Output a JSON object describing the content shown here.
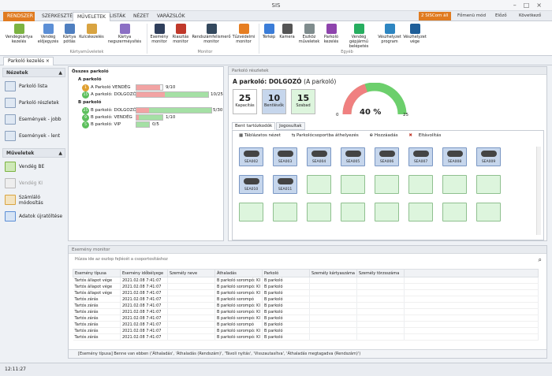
{
  "window": {
    "title": "SIS"
  },
  "ribbon_tabs": [
    "RENDSZER",
    "SZERKESZTÉS",
    "MŰVELETEK",
    "LISTÁK",
    "NÉZET",
    "VARÁZSLÓK"
  ],
  "ribbon_right": {
    "sis": "2 SISCom áll",
    "fomenu": "Főmenü mód",
    "elozo": "Előző",
    "kovetkezo": "Következő"
  },
  "ribbon_buttons": {
    "b1": "Vendégkártya kezelés",
    "b2": "Vendég előjegyzés",
    "b3": "Kártya pótlás",
    "b4": "Kulcskezelés",
    "b5": "Kártya negszerméysítés",
    "b6": "Esemény monitor",
    "b7": "Riasztás monitor",
    "b8": "Rendszámfelismerő monitor",
    "b9": "Tűzvédelmi monitor",
    "b10": "Térkép",
    "b11": "Kamera",
    "b12": "Eszköz műveletek",
    "b13": "Parkoló kezelés",
    "b14": "Vendég gépjármű belépetés",
    "b15": "Vészhelyzet program",
    "b16": "Vészhelyzet vége"
  },
  "ribbon_groups": {
    "g1": "Kártyaműveletek",
    "g2": "Monitor",
    "g3": "Egyéb"
  },
  "doctab": {
    "label": "Parkoló kezelés"
  },
  "sidebar": {
    "nezetek": "Nézetek",
    "items": [
      "Parkoló lista",
      "Parkoló részletek",
      "Események - jobb",
      "Események - lent"
    ],
    "muveletek": "Műveletek",
    "ops": [
      "Vendég BE",
      "Vendég KI",
      "Számláló módosítás",
      "Adatok újratöltése"
    ]
  },
  "tree": {
    "root": "Összes parkoló",
    "a": "A parkoló",
    "a_rows": [
      {
        "n": "1",
        "label": "A Parkoló VENDÉG",
        "v": "9/10"
      },
      {
        "n": "15",
        "label": "A parkoló: DOLGOZÓ",
        "v": "10/25"
      }
    ],
    "b": "B parkoló",
    "b_rows": [
      {
        "n": "25",
        "label": "B parkoló: DOLGOZÓK",
        "v": "5/30"
      },
      {
        "n": "9",
        "label": "B parkoló: VENDÉG",
        "v": "1/10"
      },
      {
        "n": "5",
        "label": "B parkoló: VIP",
        "v": "0/5"
      }
    ]
  },
  "details": {
    "header": "Parkoló részletek",
    "title": "A parkoló: DOLGOZÓ",
    "subtitle": "(A parkoló)",
    "kap_v": "25",
    "kap_l": "Kapacitás",
    "bent_v": "10",
    "bent_l": "Bentlévők",
    "szab_v": "15",
    "szab_l": "Szabad",
    "gauge": {
      "min": "0",
      "max": "25",
      "pct": "40 %",
      "value": 0.4
    },
    "tabs": [
      "Bent tartózkodók",
      "Jogosultak"
    ],
    "toolbar": [
      "Táblázatos nézet",
      "Parkolócsoportba áthelyezés",
      "Hozzáadás",
      "Eltávolítás"
    ],
    "spots": [
      "SEA002",
      "SEA003",
      "SEA004",
      "SEA005",
      "SEA006",
      "SEA007",
      "SEA008",
      "SEA009",
      "SEA010",
      "SEA011"
    ]
  },
  "monitor": {
    "header": "Esemény monitor",
    "hint": "Húzza ide az oszlop fejlécét a csoportosításhoz",
    "cols": [
      "Esemény típusa",
      "Esemény időbélyege",
      "Személy neve",
      "Áthaladás",
      "Parkoló",
      "Személy kártyaszáma",
      "Személy törzsszáma"
    ],
    "rows": [
      [
        "Tartós állapot vége",
        "2021.02.08 7:41:07",
        "",
        "B parkoló sorompó: KI",
        "B parkoló",
        "",
        ""
      ],
      [
        "Tartós állapot vége",
        "2021.02.08 7:41:07",
        "",
        "B parkoló sorompó: KI",
        "B parkoló",
        "",
        ""
      ],
      [
        "Tartós állapot vége",
        "2021.02.08 7:41:07",
        "",
        "B parkoló sorompó: KI",
        "B parkoló",
        "",
        ""
      ],
      [
        "Tartós zárás",
        "2021.02.08 7:41:07",
        "",
        "B parkoló sorompó",
        "B parkoló",
        "",
        ""
      ],
      [
        "Tartós zárás",
        "2021.02.08 7:41:07",
        "",
        "B parkoló sorompó: KI",
        "B parkoló",
        "",
        ""
      ],
      [
        "Tartós zárás",
        "2021.02.08 7:41:07",
        "",
        "B parkoló sorompó: KI",
        "B parkoló",
        "",
        ""
      ],
      [
        "Tartós zárás",
        "2021.02.08 7:41:07",
        "",
        "B parkoló sorompó: KI",
        "B parkoló",
        "",
        ""
      ],
      [
        "Tartós zárás",
        "2021.02.08 7:41:07",
        "",
        "B parkoló sorompó",
        "B parkoló",
        "",
        ""
      ],
      [
        "Tartós zárás",
        "2021.02.08 7:41:07",
        "",
        "B parkoló sorompó: KI",
        "B parkoló",
        "",
        ""
      ],
      [
        "Tartós zárás",
        "2021.02.08 7:41:07",
        "",
        "B parkoló sorompó: KI",
        "B parkoló",
        "",
        ""
      ]
    ],
    "filter": "[Esemény típusa] Benne van ebben ('Áthaladás', 'Áthaladás (Rendszám)', 'Távoli nyitás', 'Visszautasítva', 'Áthaladás megtagadva (Rendszám)')"
  },
  "status": {
    "time": "12:11:27"
  },
  "colors": {
    "accent": "#e07b20",
    "green": "#5cbf5c",
    "red": "#f08080"
  }
}
